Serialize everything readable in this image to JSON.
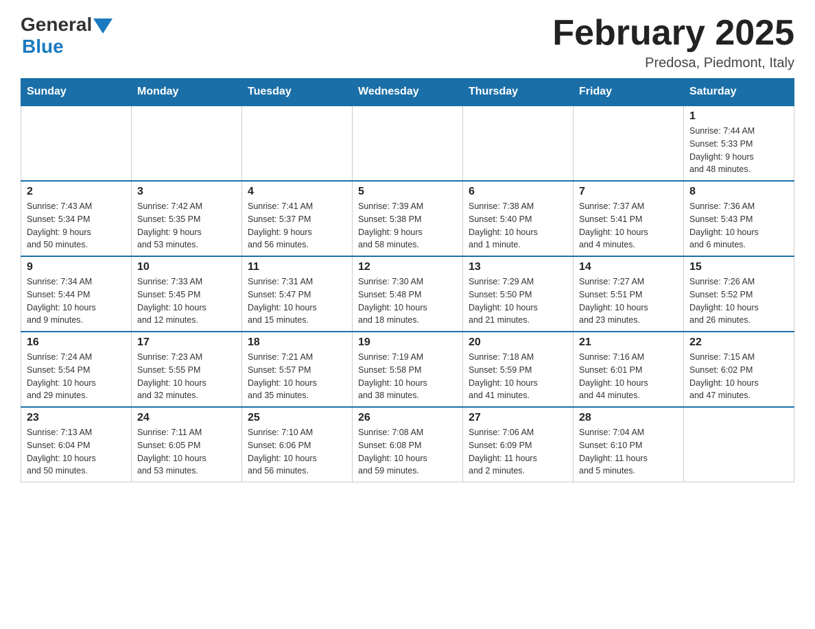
{
  "header": {
    "logo": {
      "general_text": "General",
      "blue_text": "Blue"
    },
    "title": "February 2025",
    "subtitle": "Predosa, Piedmont, Italy"
  },
  "weekdays": [
    "Sunday",
    "Monday",
    "Tuesday",
    "Wednesday",
    "Thursday",
    "Friday",
    "Saturday"
  ],
  "weeks": [
    [
      {
        "day": "",
        "info": ""
      },
      {
        "day": "",
        "info": ""
      },
      {
        "day": "",
        "info": ""
      },
      {
        "day": "",
        "info": ""
      },
      {
        "day": "",
        "info": ""
      },
      {
        "day": "",
        "info": ""
      },
      {
        "day": "1",
        "info": "Sunrise: 7:44 AM\nSunset: 5:33 PM\nDaylight: 9 hours\nand 48 minutes."
      }
    ],
    [
      {
        "day": "2",
        "info": "Sunrise: 7:43 AM\nSunset: 5:34 PM\nDaylight: 9 hours\nand 50 minutes."
      },
      {
        "day": "3",
        "info": "Sunrise: 7:42 AM\nSunset: 5:35 PM\nDaylight: 9 hours\nand 53 minutes."
      },
      {
        "day": "4",
        "info": "Sunrise: 7:41 AM\nSunset: 5:37 PM\nDaylight: 9 hours\nand 56 minutes."
      },
      {
        "day": "5",
        "info": "Sunrise: 7:39 AM\nSunset: 5:38 PM\nDaylight: 9 hours\nand 58 minutes."
      },
      {
        "day": "6",
        "info": "Sunrise: 7:38 AM\nSunset: 5:40 PM\nDaylight: 10 hours\nand 1 minute."
      },
      {
        "day": "7",
        "info": "Sunrise: 7:37 AM\nSunset: 5:41 PM\nDaylight: 10 hours\nand 4 minutes."
      },
      {
        "day": "8",
        "info": "Sunrise: 7:36 AM\nSunset: 5:43 PM\nDaylight: 10 hours\nand 6 minutes."
      }
    ],
    [
      {
        "day": "9",
        "info": "Sunrise: 7:34 AM\nSunset: 5:44 PM\nDaylight: 10 hours\nand 9 minutes."
      },
      {
        "day": "10",
        "info": "Sunrise: 7:33 AM\nSunset: 5:45 PM\nDaylight: 10 hours\nand 12 minutes."
      },
      {
        "day": "11",
        "info": "Sunrise: 7:31 AM\nSunset: 5:47 PM\nDaylight: 10 hours\nand 15 minutes."
      },
      {
        "day": "12",
        "info": "Sunrise: 7:30 AM\nSunset: 5:48 PM\nDaylight: 10 hours\nand 18 minutes."
      },
      {
        "day": "13",
        "info": "Sunrise: 7:29 AM\nSunset: 5:50 PM\nDaylight: 10 hours\nand 21 minutes."
      },
      {
        "day": "14",
        "info": "Sunrise: 7:27 AM\nSunset: 5:51 PM\nDaylight: 10 hours\nand 23 minutes."
      },
      {
        "day": "15",
        "info": "Sunrise: 7:26 AM\nSunset: 5:52 PM\nDaylight: 10 hours\nand 26 minutes."
      }
    ],
    [
      {
        "day": "16",
        "info": "Sunrise: 7:24 AM\nSunset: 5:54 PM\nDaylight: 10 hours\nand 29 minutes."
      },
      {
        "day": "17",
        "info": "Sunrise: 7:23 AM\nSunset: 5:55 PM\nDaylight: 10 hours\nand 32 minutes."
      },
      {
        "day": "18",
        "info": "Sunrise: 7:21 AM\nSunset: 5:57 PM\nDaylight: 10 hours\nand 35 minutes."
      },
      {
        "day": "19",
        "info": "Sunrise: 7:19 AM\nSunset: 5:58 PM\nDaylight: 10 hours\nand 38 minutes."
      },
      {
        "day": "20",
        "info": "Sunrise: 7:18 AM\nSunset: 5:59 PM\nDaylight: 10 hours\nand 41 minutes."
      },
      {
        "day": "21",
        "info": "Sunrise: 7:16 AM\nSunset: 6:01 PM\nDaylight: 10 hours\nand 44 minutes."
      },
      {
        "day": "22",
        "info": "Sunrise: 7:15 AM\nSunset: 6:02 PM\nDaylight: 10 hours\nand 47 minutes."
      }
    ],
    [
      {
        "day": "23",
        "info": "Sunrise: 7:13 AM\nSunset: 6:04 PM\nDaylight: 10 hours\nand 50 minutes."
      },
      {
        "day": "24",
        "info": "Sunrise: 7:11 AM\nSunset: 6:05 PM\nDaylight: 10 hours\nand 53 minutes."
      },
      {
        "day": "25",
        "info": "Sunrise: 7:10 AM\nSunset: 6:06 PM\nDaylight: 10 hours\nand 56 minutes."
      },
      {
        "day": "26",
        "info": "Sunrise: 7:08 AM\nSunset: 6:08 PM\nDaylight: 10 hours\nand 59 minutes."
      },
      {
        "day": "27",
        "info": "Sunrise: 7:06 AM\nSunset: 6:09 PM\nDaylight: 11 hours\nand 2 minutes."
      },
      {
        "day": "28",
        "info": "Sunrise: 7:04 AM\nSunset: 6:10 PM\nDaylight: 11 hours\nand 5 minutes."
      },
      {
        "day": "",
        "info": ""
      }
    ]
  ]
}
